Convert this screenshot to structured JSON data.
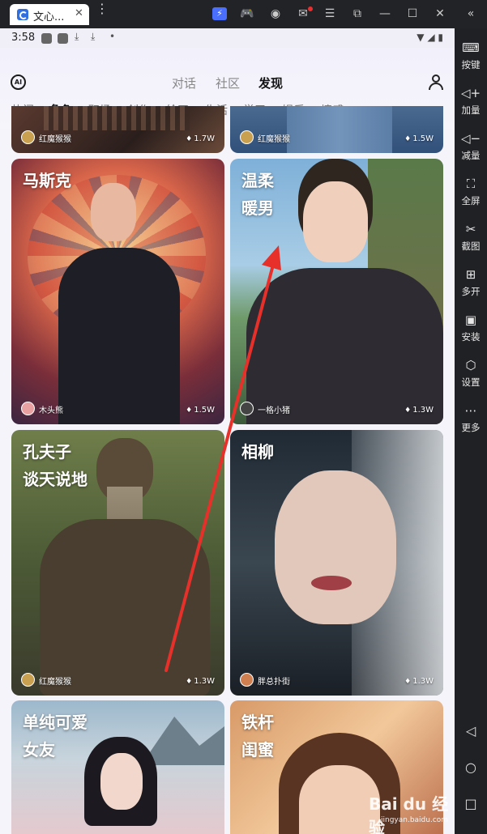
{
  "emulator": {
    "tab_title": "文心...",
    "tab_close": "✕",
    "menu_dots": "⋮",
    "window_icons": [
      "lightning-icon",
      "gamepad-icon",
      "account-icon",
      "mail-icon",
      "menu-icon",
      "screenshot-icon",
      "minimize-icon",
      "maximize-icon",
      "close-icon",
      "collapse-icon"
    ],
    "sidebar": [
      {
        "icon": "keyboard-icon",
        "label": "按键"
      },
      {
        "icon": "volume-up-icon",
        "label": "加量"
      },
      {
        "icon": "volume-down-icon",
        "label": "减量"
      },
      {
        "icon": "fullscreen-icon",
        "label": "全屏"
      },
      {
        "icon": "scissors-icon",
        "label": "截图"
      },
      {
        "icon": "multi-open-icon",
        "label": "多开"
      },
      {
        "icon": "apk-install-icon",
        "label": "安装"
      },
      {
        "icon": "settings-icon",
        "label": "设置"
      },
      {
        "icon": "more-icon",
        "label": "更多"
      }
    ]
  },
  "status_bar": {
    "time": "3:58"
  },
  "header": {
    "logo": "AI",
    "tabs": [
      {
        "label": "对话",
        "active": false
      },
      {
        "label": "社区",
        "active": false
      },
      {
        "label": "发现",
        "active": true
      }
    ]
  },
  "categories": [
    {
      "label": "热门",
      "active": false
    },
    {
      "label": "角色",
      "active": true
    },
    {
      "label": "职场",
      "active": false
    },
    {
      "label": "创作",
      "active": false
    },
    {
      "label": "绘画",
      "active": false
    },
    {
      "label": "生活",
      "active": false
    },
    {
      "label": "学习",
      "active": false
    },
    {
      "label": "娱乐",
      "active": false
    },
    {
      "label": "情感",
      "active": false
    }
  ],
  "cards": [
    {
      "title": "",
      "author": "红魔猴猴",
      "count": "1.7W"
    },
    {
      "title": "",
      "author": "红魔猴猴",
      "count": "1.5W"
    },
    {
      "title": "马斯克",
      "author": "木头熊",
      "count": "1.5W"
    },
    {
      "title": "温柔\n暖男",
      "author": "一格小猪",
      "count": "1.3W"
    },
    {
      "title": "孔夫子\n谈天说地",
      "author": "红魔猴猴",
      "count": "1.3W"
    },
    {
      "title": "相柳",
      "author": "胖总扑街",
      "count": "1.3W"
    },
    {
      "title": "单纯可爱\n女友",
      "author": "",
      "count": ""
    },
    {
      "title": "铁杆\n闺蜜",
      "author": "",
      "count": ""
    }
  ],
  "annotation": {
    "color": "#e8302a"
  },
  "watermark": {
    "text": "Bai du 经验",
    "sub": "jingyan.baidu.com"
  }
}
